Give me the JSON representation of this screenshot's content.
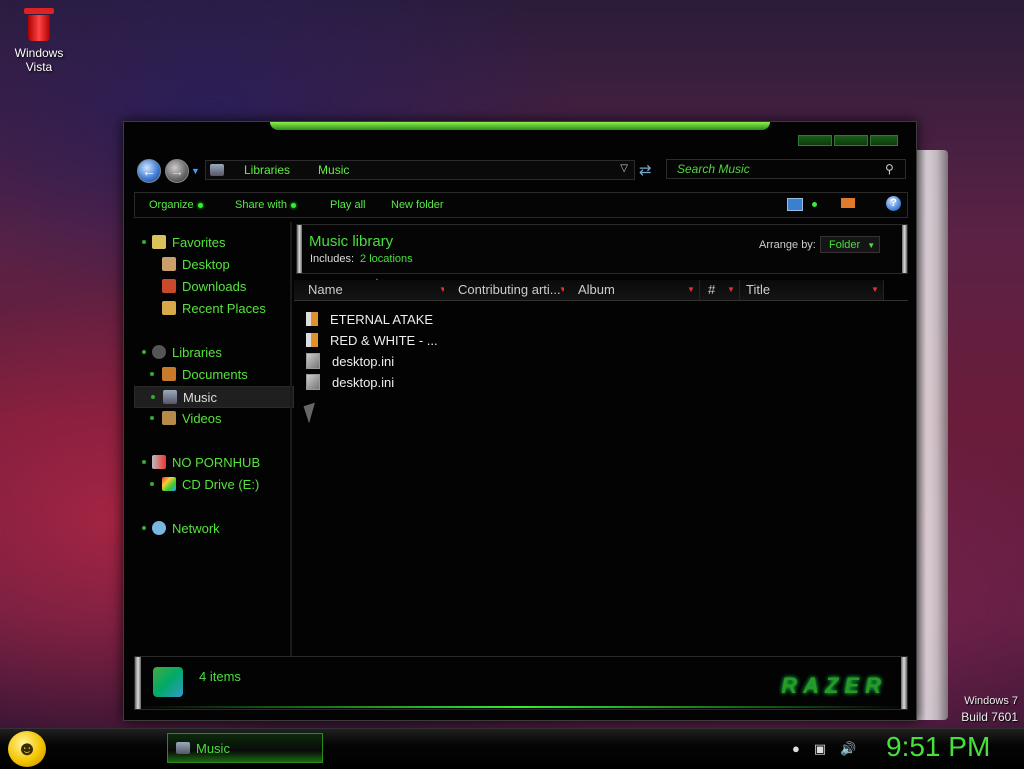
{
  "desktop": {
    "recycle_bin_label_line1": "Windows",
    "recycle_bin_label_line2": "Vista",
    "watermark_line1": "Windows 7",
    "watermark_line2": "Build 7601"
  },
  "theme": {
    "accent": "#46e03a",
    "background": "#030303",
    "sort_arrow": "#d33333"
  },
  "explorer": {
    "breadcrumb": [
      "Libraries",
      "Music"
    ],
    "search_placeholder": "Search Music",
    "toolbar": {
      "organize": "Organize",
      "share_with": "Share with",
      "play_all": "Play all",
      "new_folder": "New folder"
    },
    "nav": {
      "favorites": "Favorites",
      "desktop": "Desktop",
      "downloads": "Downloads",
      "recent_places": "Recent Places",
      "libraries": "Libraries",
      "documents": "Documents",
      "music": "Music",
      "videos": "Videos",
      "computer_drive": "NO PORNHUB",
      "cd_drive": "CD Drive (E:)",
      "network": "Network"
    },
    "library": {
      "title": "Music library",
      "includes_label": "Includes:",
      "includes_link": "2 locations",
      "arrange_label": "Arrange by:",
      "arrange_value": "Folder"
    },
    "columns": [
      "Name",
      "Contributing arti...",
      "Album",
      "#",
      "Title"
    ],
    "files": [
      {
        "name": "ETERNAL ATAKE",
        "icon": "music-folder-icon"
      },
      {
        "name": "RED & WHITE - ...",
        "icon": "music-folder-icon"
      },
      {
        "name": "desktop.ini",
        "icon": "ini-file-icon"
      },
      {
        "name": "desktop.ini",
        "icon": "ini-file-icon"
      }
    ],
    "status": {
      "item_count": "4 items",
      "brand": "RAZER"
    }
  },
  "taskbar": {
    "task_label": "Music",
    "clock": "9:51 PM"
  }
}
